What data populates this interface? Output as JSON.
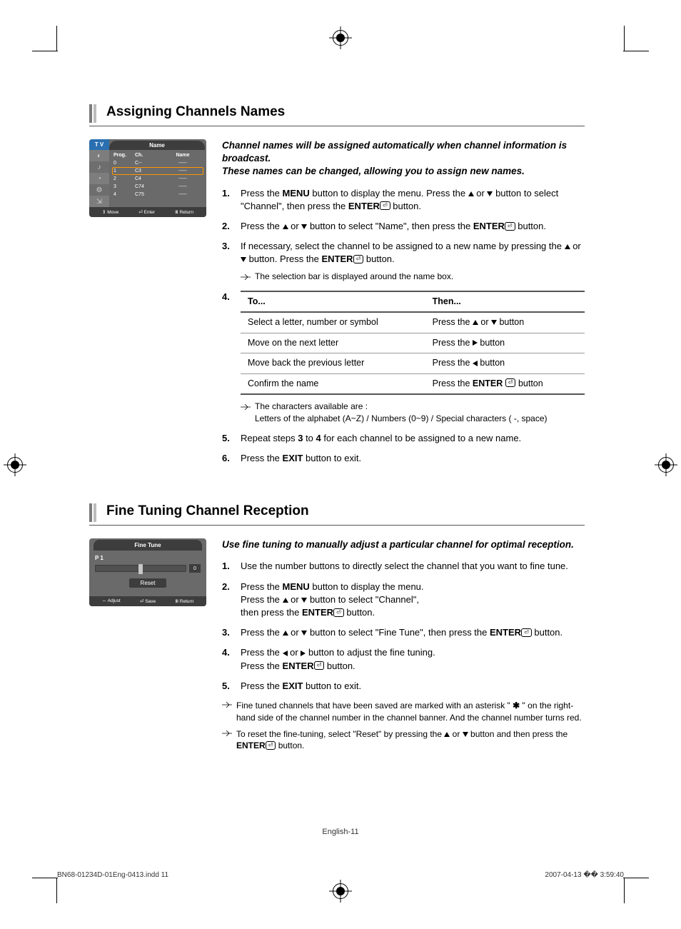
{
  "section1": {
    "heading": "Assigning Channels Names",
    "intro_line1": "Channel names will be assigned automatically when channel information is broadcast.",
    "intro_line2": "These names can be changed, allowing you to assign new names.",
    "osd": {
      "tv": "T V",
      "title": "Name",
      "head": {
        "prog": "Prog.",
        "ch": "Ch.",
        "name": "Name"
      },
      "rows": [
        {
          "prog": "0",
          "ch": "C--",
          "name": "-----"
        },
        {
          "prog": "1",
          "ch": "C3",
          "name": "-----"
        },
        {
          "prog": "2",
          "ch": "C4",
          "name": "-----"
        },
        {
          "prog": "3",
          "ch": "C74",
          "name": "-----"
        },
        {
          "prog": "4",
          "ch": "C75",
          "name": "-----"
        }
      ],
      "footer": {
        "move": "Move",
        "enter": "Enter",
        "return": "Return"
      }
    },
    "steps": {
      "s1a": "Press the ",
      "s1b": "MENU",
      "s1c": " button to display the menu.  Press the ",
      "s1d": " or ",
      "s1e": " button to select \"Channel\", then press the ",
      "s1f": "ENTER",
      "s1g": " button.",
      "s2a": "Press the ",
      "s2b": " or ",
      "s2c": " button to select \"Name\", then press the ",
      "s2d": "ENTER",
      "s2e": " button.",
      "s3a": "If necessary, select the channel to be assigned to a new name by pressing the ",
      "s3b": " or ",
      "s3c": " button. Press the ",
      "s3d": "ENTER",
      "s3e": " button.",
      "s3_note": "The selection bar is displayed around the name box.",
      "s5a": "Repeat steps ",
      "s5b": "3",
      "s5c": " to ",
      "s5d": "4",
      "s5e": " for each channel to be assigned to a new name.",
      "s6a": "Press the ",
      "s6b": "EXIT",
      "s6c": " button to exit."
    },
    "table": {
      "th1": "To...",
      "th2": "Then...",
      "r1c1": "Select a letter, number or symbol",
      "r1c2a": "Press the ",
      "r1c2b": " or ",
      "r1c2c": " button",
      "r2c1": "Move on the next letter",
      "r2c2a": "Press the ",
      "r2c2b": " button",
      "r3c1": "Move back the previous letter",
      "r3c2a": "Press the ",
      "r3c2b": " button",
      "r4c1": "Confirm the name",
      "r4c2a": "Press the ",
      "r4c2b": "ENTER",
      "r4c2c": " button"
    },
    "chars_note_a": "The characters available are :",
    "chars_note_b": "Letters of the alphabet (A~Z) / Numbers (0~9) / Special characters ( -, space)"
  },
  "section2": {
    "heading": "Fine Tuning Channel Reception",
    "intro": "Use fine tuning to manually adjust a particular channel for optimal reception.",
    "osd": {
      "title": "Fine Tune",
      "p": "P  1",
      "val": "0",
      "reset": "Reset",
      "footer": {
        "adjust": "Adjust",
        "save": "Save",
        "return": "Return"
      }
    },
    "steps": {
      "s1": "Use the number buttons to directly select the channel that you want to fine tune.",
      "s2a": "Press the ",
      "s2b": "MENU",
      "s2c": " button to display the menu.",
      "s2d": "Press the ",
      "s2e": " or ",
      "s2f": " button to select \"Channel\",",
      "s2g": "then press the ",
      "s2h": "ENTER",
      "s2i": " button.",
      "s3a": "Press the ",
      "s3b": " or ",
      "s3c": " button to select \"Fine Tune\", then press the ",
      "s3d": "ENTER",
      "s3e": " button.",
      "s4a": "Press the ",
      "s4b": " or ",
      "s4c": " button to adjust the fine tuning.",
      "s4d": "Press the ",
      "s4e": "ENTER",
      "s4f": " button.",
      "s5a": "Press the ",
      "s5b": "EXIT",
      "s5c": " button to exit."
    },
    "note1a": "Fine tuned channels that have been saved are marked with an asterisk \" ",
    "note1b": " \" on the right-hand side of the channel number in the channel banner.  And the channel number turns red.",
    "note2a": "To reset the fine-tuning, select \"Reset\" by pressing the ",
    "note2b": " or ",
    "note2c": " button and then press the ",
    "note2d": "ENTER",
    "note2e": " button."
  },
  "page_number": "English-11",
  "footer": {
    "file": "BN68-01234D-01Eng-0413.indd   11",
    "date": "2007-04-13   �� 3:59:40"
  }
}
